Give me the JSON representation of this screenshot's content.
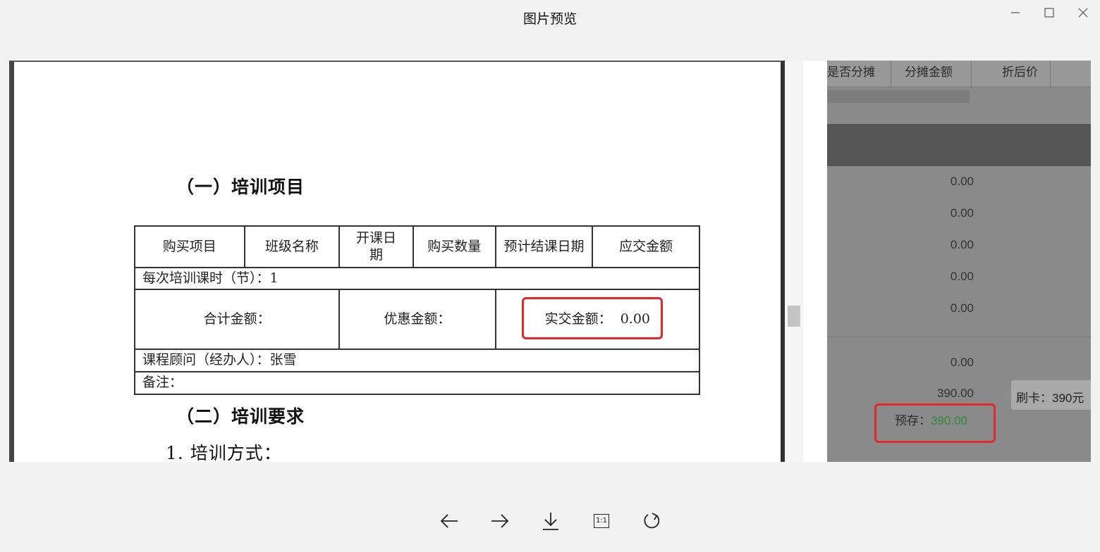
{
  "window": {
    "title": "图片预览"
  },
  "document": {
    "section1_title": "（一）培训项目",
    "table": {
      "headers": [
        "购买项目",
        "班级名称",
        "开课日期",
        "购买数量",
        "预计结课日期",
        "应交金额"
      ],
      "hours_row": "每次培训课时（节）：1",
      "total_label": "合计金额：",
      "discount_label": "优惠金额：",
      "paid_label": "实交金额：",
      "paid_value": "0.00",
      "advisor_row": "课程顾问（经办人）：张雪",
      "remark_row": "备注："
    },
    "section2_title": "（二）培训要求",
    "item1": "1. 培训方式："
  },
  "software": {
    "headers": [
      "是否分摊",
      "分摊金额",
      "折后价"
    ],
    "values": [
      "0.00",
      "0.00",
      "0.00",
      "0.00",
      "0.00",
      "0.00",
      "390.00"
    ],
    "tooltip": "刷卡：390元",
    "prestore_label": "预存：",
    "prestore_value": "390.00",
    "prestore_color": "#2e8b3a"
  },
  "toolbar": {
    "buttons": [
      "prev-icon",
      "next-icon",
      "download-icon",
      "actual-size-icon",
      "rotate-icon"
    ],
    "actual_size_label": "1:1"
  },
  "colors": {
    "highlight": "#e8262a",
    "background": "#f2f2f2"
  }
}
